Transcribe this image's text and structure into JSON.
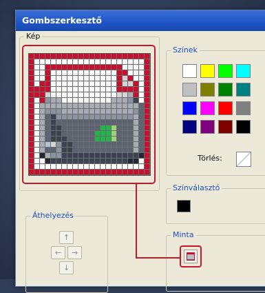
{
  "window": {
    "title": "Gombszerkesztő"
  },
  "picture": {
    "label": "Kép"
  },
  "colors": {
    "label": "Színek",
    "swatches": [
      "#ffffff",
      "#ffff00",
      "#00ff00",
      "#00ffff",
      "#c0c0c0",
      "#808000",
      "#008000",
      "#008080",
      "#0000ff",
      "#ff00ff",
      "#ff0000",
      "#808080",
      "#000080",
      "#800080",
      "#800000",
      "#000000"
    ],
    "clear_label": "Törlés:"
  },
  "picker": {
    "label": "Színválasztó",
    "selected_color": "#000000"
  },
  "move": {
    "label": "Áthelyezés",
    "up": "↑",
    "left": "←",
    "right": "→",
    "down": "↓"
  },
  "preview": {
    "label": "Minta"
  },
  "pixel_palette": {
    "R": "#c8102e",
    "W": "#ffffff",
    "L": "#d4d4d4",
    "S": "#a8acb4",
    "M": "#8c94a2",
    "D": "#5c6474",
    "K": "#3c4252",
    "N": "#222836",
    "G": "#22b34a",
    "Y": "#9bd17a",
    "B": "#b8c2d6"
  },
  "pixels": [
    "RRRRRRRRRRRRRRRRRRRRRR",
    "RWWWWWWWWWWWWWWWWWWWWR",
    "RWWRRRRRRRRRRRRRRWWWWR",
    "RWWRWWWWWWWWWWWWRRWWWR",
    "RWWRWWWWWWWWWWWWRLRWWR",
    "RWRRWWWWWWWWWWWWRLLRWR",
    "RRRRWWWWWWWWWWWWRRRRWR",
    "RRRLWWWWWWWWWWWWLLSRWR",
    "RWRMSSWWWWWWWWWSSSMKWR",
    "RWSSSSSSSSSSSSSSSSSSDR",
    "RWSMMMSSSSSSSSSSSSSMDR",
    "RWSDKMMMMMMMMMMMMMMSDR",
    "RWSDKDDDDDDDDDDDDDDSDR",
    "RWSDKKDDDDDDDGGYDDDSDR",
    "RWSDKKDDDDDDGGGYDDDSDR",
    "RWSDKKKDDDDDGGGYDDDSDR",
    "RWSBLMKKDDDDDDDDDDDSDR",
    "RWSDDMKKDDDDDDDDDDDSDR",
    "RWNSMMKKKKKKKKKKKKKKNR",
    "RWWNKKKKKKKKKKKKKKNNWR",
    "RWWWWWWWWWWWWWWWWWWWWR",
    "RRRRRRRRRRRRRRRRRRRRRR"
  ]
}
